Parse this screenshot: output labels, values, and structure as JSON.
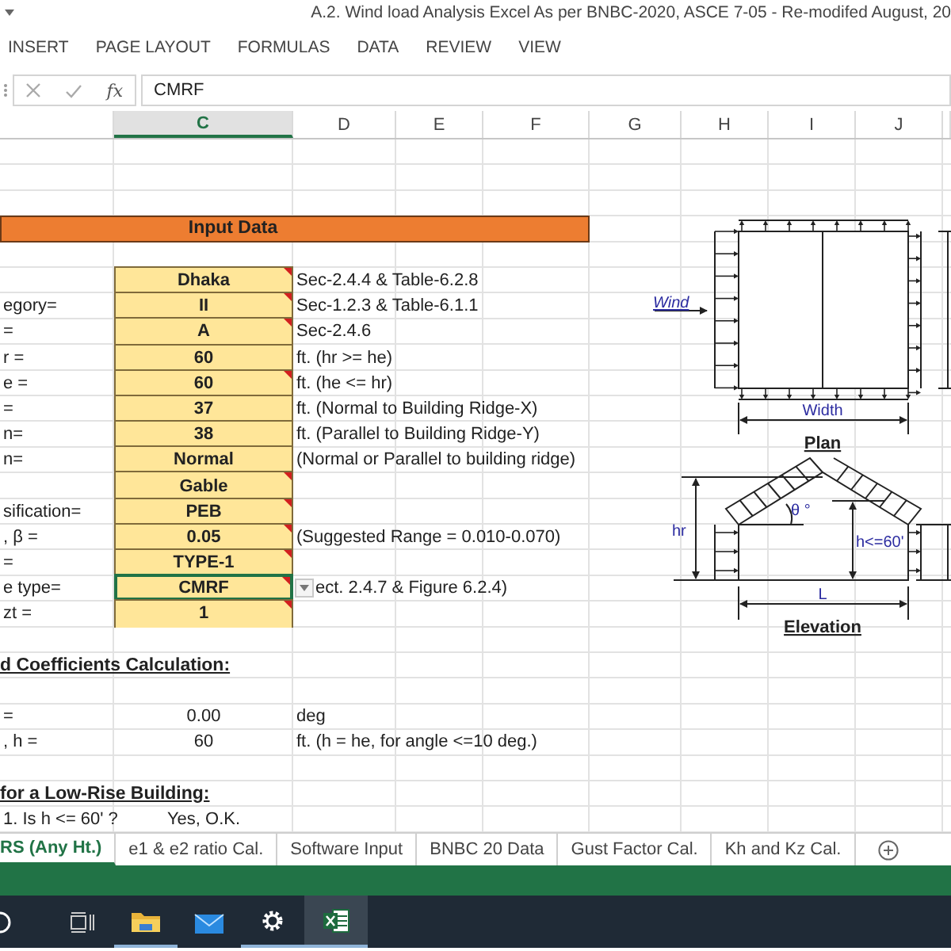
{
  "title_bar": {
    "title": "A.2. Wind load Analysis Excel As per BNBC-2020, ASCE 7-05 - Re-modifed August, 20"
  },
  "ribbon_tabs": [
    "INSERT",
    "PAGE LAYOUT",
    "FORMULAS",
    "DATA",
    "REVIEW",
    "VIEW"
  ],
  "formula_bar": {
    "function_symbol": "fx",
    "value": "CMRF"
  },
  "columns": [
    {
      "label": "C",
      "selected": true
    },
    {
      "label": "D",
      "selected": false
    },
    {
      "label": "E",
      "selected": false
    },
    {
      "label": "F",
      "selected": false
    },
    {
      "label": "G",
      "selected": false
    },
    {
      "label": "H",
      "selected": false
    },
    {
      "label": "I",
      "selected": false
    },
    {
      "label": "J",
      "selected": false
    }
  ],
  "rows": [
    {
      "kind": "blank"
    },
    {
      "kind": "blank"
    },
    {
      "kind": "blank"
    },
    {
      "kind": "section",
      "title": "Input Data"
    },
    {
      "kind": "blank"
    },
    {
      "kind": "input",
      "value": "Dhaka",
      "note": "Sec-2.4.4 & Table-6.2.8",
      "comment": true,
      "selected": false
    },
    {
      "kind": "input",
      "label": "egory=",
      "value": "II",
      "note": "Sec-1.2.3 & Table-6.1.1",
      "comment": true,
      "selected": false
    },
    {
      "kind": "input",
      "label": "=",
      "value": "A",
      "note": "Sec-2.4.6",
      "comment": true,
      "selected": false
    },
    {
      "kind": "input",
      "label": "r =",
      "value": "60",
      "note": "ft. (hr >= he)",
      "selected": false
    },
    {
      "kind": "input",
      "label": "e =",
      "value": "60",
      "note": "ft. (he <= hr)",
      "comment": true,
      "selected": false
    },
    {
      "kind": "input",
      "label": "=",
      "value": "37",
      "note": "ft. (Normal to Building Ridge-X)",
      "selected": false
    },
    {
      "kind": "input",
      "label": "n=",
      "value": "38",
      "note": "ft. (Parallel to Building Ridge-Y)",
      "selected": false
    },
    {
      "kind": "input",
      "label": "n=",
      "value": "Normal",
      "note": "(Normal or Parallel to building ridge)",
      "selected": false
    },
    {
      "kind": "input",
      "value": "Gable",
      "comment": true,
      "selected": false
    },
    {
      "kind": "input",
      "label": "sification=",
      "value": "PEB",
      "comment": true,
      "selected": false
    },
    {
      "kind": "input",
      "label": ", β =",
      "value": "0.05",
      "note": "(Suggested Range = 0.010-0.070)",
      "comment": true,
      "selected": false
    },
    {
      "kind": "input",
      "label": "=",
      "value": "TYPE-1",
      "comment": true,
      "selected": false
    },
    {
      "kind": "input",
      "label": "e type=",
      "value": "CMRF",
      "note": "ect. 2.4.7 & Figure 6.2.4)",
      "comment": true,
      "selected": true
    },
    {
      "kind": "input",
      "label": "zt =",
      "value": "1",
      "comment": true,
      "selected": false
    },
    {
      "kind": "blank"
    },
    {
      "kind": "heading",
      "title": "d Coefficients Calculation:"
    },
    {
      "kind": "blank"
    },
    {
      "kind": "calc",
      "label": "=",
      "value": "0.00",
      "note": "deg"
    },
    {
      "kind": "calc",
      "label": ", h =",
      "value": "60",
      "note": "ft. (h = he, for angle <=10 deg.)"
    },
    {
      "kind": "blank"
    },
    {
      "kind": "heading",
      "title": "for a Low-Rise Building:"
    },
    {
      "kind": "calc",
      "label": "1.  Is h <= 60' ?",
      "value": "Yes, O.K."
    }
  ],
  "diagram": {
    "wind_label": "Wind",
    "width_label": "Width",
    "plan_title": "Plan",
    "hr_label": "hr",
    "angle_label": "θ °",
    "height_label": "h<=60'",
    "length_label": "L",
    "elevation_title": "Elevation"
  },
  "sheet_tabs": [
    {
      "label": "RS (Any Ht.)",
      "selected": true
    },
    {
      "label": "e1 & e2 ratio Cal.",
      "selected": false
    },
    {
      "label": "Software Input",
      "selected": false
    },
    {
      "label": "BNBC 20 Data",
      "selected": false
    },
    {
      "label": "Gust Factor Cal.",
      "selected": false
    },
    {
      "label": "Kh and Kz Cal.",
      "selected": false
    }
  ]
}
